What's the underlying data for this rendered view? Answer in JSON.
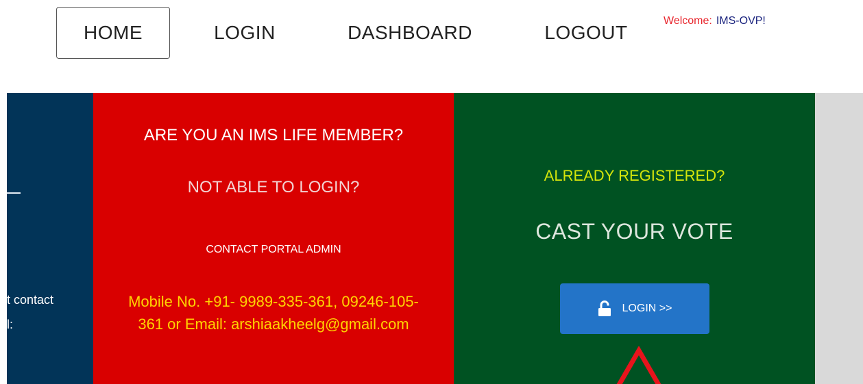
{
  "nav": {
    "items": [
      {
        "label": "HOME"
      },
      {
        "label": "LOGIN"
      },
      {
        "label": "DASHBOARD"
      },
      {
        "label": "LOGOUT"
      }
    ],
    "welcome_label": "Welcome:",
    "welcome_user": "IMS-OVP!"
  },
  "left_panel": {
    "text_line_1": "t contact",
    "text_line_2": "l:"
  },
  "red_panel": {
    "question_1": "ARE YOU AN IMS LIFE MEMBER?",
    "question_2": "NOT ABLE TO LOGIN?",
    "contact_heading": "CONTACT PORTAL ADMIN",
    "contact_info": "Mobile No. +91- 9989-335-361, 09246-105-361 or Email: arshiaakheelg@gmail.com"
  },
  "green_panel": {
    "question": "ALREADY REGISTERED?",
    "title": "CAST YOUR VOTE",
    "login_button_label": "LOGIN >>",
    "login_button_icon": "unlock-icon"
  },
  "colors": {
    "navy": "#023458",
    "red": "#d90000",
    "green": "#005222",
    "button_blue": "#2374c8",
    "contact_yellow": "#ffd400",
    "question_yellow_green": "#d4e60b",
    "welcome_red": "#e8242b",
    "welcome_user_blue": "#1a237e",
    "annotation_red": "#e8141c"
  }
}
